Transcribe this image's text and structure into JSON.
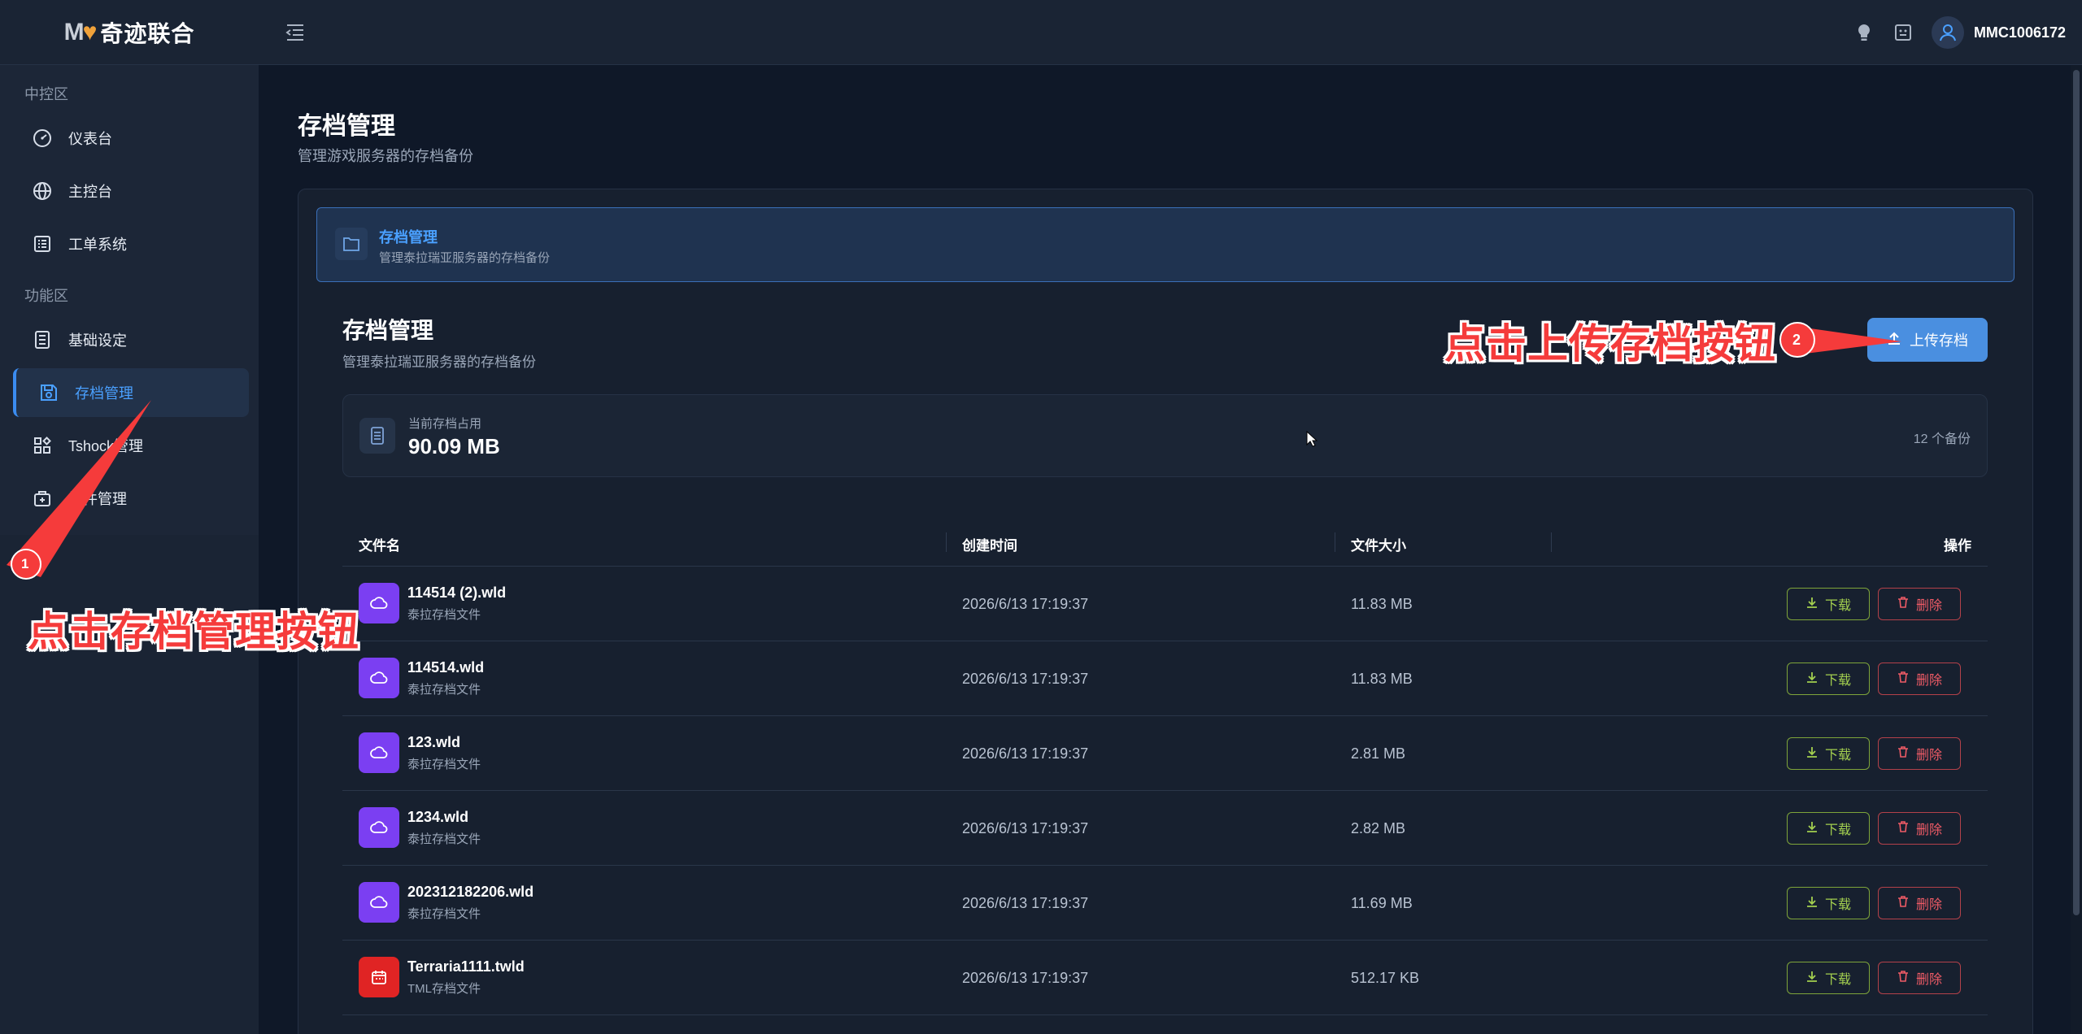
{
  "brand": {
    "logo_mark": "MV",
    "name": "奇迹联合"
  },
  "header": {
    "username": "MMC1006172"
  },
  "sidebar": {
    "section1": "中控区",
    "section2": "功能区",
    "items": [
      {
        "label": "仪表台",
        "icon": "gauge-icon"
      },
      {
        "label": "主控台",
        "icon": "globe-icon"
      },
      {
        "label": "工单系统",
        "icon": "ticket-icon"
      },
      {
        "label": "基础设定",
        "icon": "settings-list-icon"
      },
      {
        "label": "存档管理",
        "icon": "save-icon",
        "active": true
      },
      {
        "label": "Tshock管理",
        "icon": "apps-icon"
      },
      {
        "label": "插件管理",
        "icon": "plugin-icon"
      }
    ]
  },
  "page": {
    "title": "存档管理",
    "subtitle": "管理游戏服务器的存档备份"
  },
  "crumb": {
    "title": "存档管理",
    "subtitle": "管理泰拉瑞亚服务器的存档备份"
  },
  "section": {
    "title": "存档管理",
    "subtitle": "管理泰拉瑞亚服务器的存档备份",
    "upload_label": "上传存档"
  },
  "storage": {
    "label": "当前存档占用",
    "value": "90.09 MB",
    "count": "12 个备份"
  },
  "table": {
    "headers": {
      "name": "文件名",
      "time": "创建时间",
      "size": "文件大小",
      "actions": "操作"
    },
    "download_label": "下载",
    "delete_label": "删除",
    "rows": [
      {
        "name": "114514 (2).wld",
        "type": "泰拉存档文件",
        "time": "2026/6/13 17:19:37",
        "size": "11.83 MB",
        "kind": "wld"
      },
      {
        "name": "114514.wld",
        "type": "泰拉存档文件",
        "time": "2026/6/13 17:19:37",
        "size": "11.83 MB",
        "kind": "wld"
      },
      {
        "name": "123.wld",
        "type": "泰拉存档文件",
        "time": "2026/6/13 17:19:37",
        "size": "2.81 MB",
        "kind": "wld"
      },
      {
        "name": "1234.wld",
        "type": "泰拉存档文件",
        "time": "2026/6/13 17:19:37",
        "size": "2.82 MB",
        "kind": "wld"
      },
      {
        "name": "202312182206.wld",
        "type": "泰拉存档文件",
        "time": "2026/6/13 17:19:37",
        "size": "11.69 MB",
        "kind": "wld"
      },
      {
        "name": "Terraria1111.twld",
        "type": "TML存档文件",
        "time": "2026/6/13 17:19:37",
        "size": "512.17 KB",
        "kind": "twld"
      }
    ]
  },
  "annotations": {
    "step1_text": "点击存档管理按钮",
    "step1_num": "1",
    "step2_text": "点击上传存档按钮",
    "step2_num": "2",
    "color": "#f53b3b"
  }
}
